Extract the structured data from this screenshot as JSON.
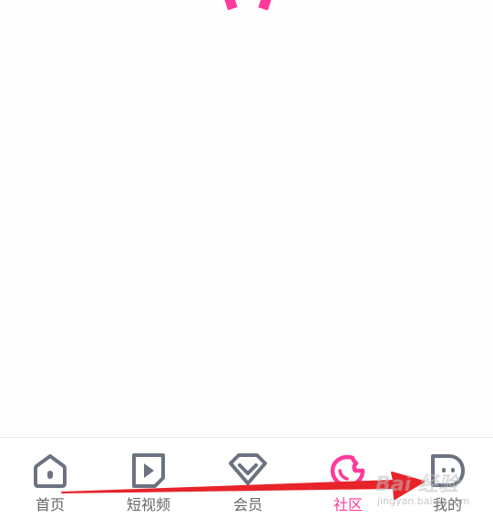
{
  "bottom_nav": {
    "items": [
      {
        "label": "首页",
        "icon": "home-icon",
        "active": false
      },
      {
        "label": "短视频",
        "icon": "play-video-icon",
        "active": false
      },
      {
        "label": "会员",
        "icon": "diamond-icon",
        "active": false
      },
      {
        "label": "社区",
        "icon": "community-icon",
        "active": true
      },
      {
        "label": "我的",
        "icon": "profile-face-icon",
        "active": false
      }
    ]
  },
  "colors": {
    "accent": "#ff3a9a",
    "inactive_icon": "#6b7280",
    "inactive_text": "#666666",
    "annotation_arrow": "#e8232a"
  },
  "watermark": {
    "logo": "Bai 经验",
    "url": "jingyan.baidu.com"
  }
}
